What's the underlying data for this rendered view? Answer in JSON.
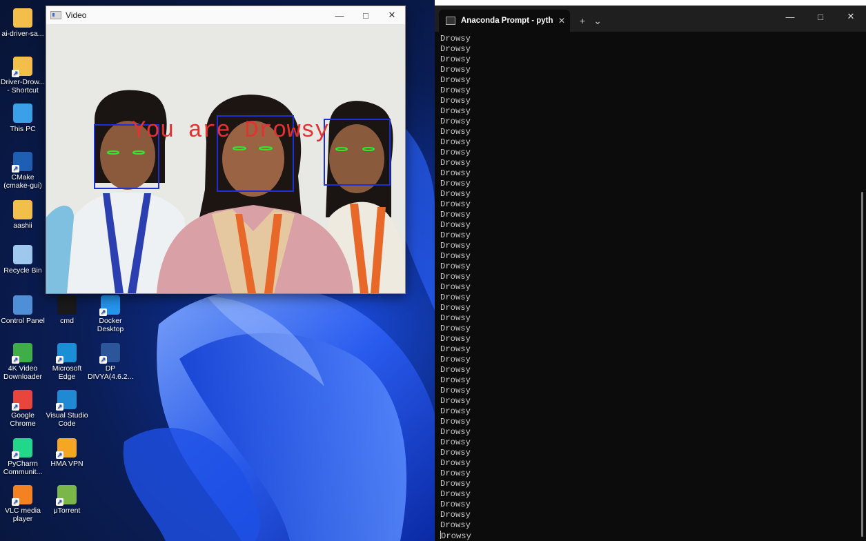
{
  "desktop": {
    "icons": [
      {
        "label": "ai-driver-sa...",
        "icon": "folder-icon",
        "color": "#f2c04a"
      },
      {
        "label": "Driver-Drow... - Shortcut",
        "icon": "folder-shortcut-icon",
        "color": "#f2c04a"
      },
      {
        "label": "This PC",
        "icon": "monitor-icon",
        "color": "#3aa0e8"
      },
      {
        "label": "CMake (cmake-gui)",
        "icon": "cmake-icon",
        "color": "#1e5fb4"
      },
      {
        "label": "aashii",
        "icon": "folder-icon",
        "color": "#f2c04a"
      },
      {
        "label": "Recycle Bin",
        "icon": "recycle-bin-icon",
        "color": "#9ec8ee"
      },
      {
        "label": "Control Panel",
        "icon": "control-panel-icon",
        "color": "#4f8fd6"
      },
      {
        "label": "cmd",
        "icon": "cmd-icon",
        "color": "#1a1a1a"
      },
      {
        "label": "Docker Desktop",
        "icon": "docker-icon",
        "color": "#2496ed"
      },
      {
        "label": "4K Video Downloader",
        "icon": "video-downloader-icon",
        "color": "#3fae49"
      },
      {
        "label": "Microsoft Edge",
        "icon": "edge-icon",
        "color": "#1b8fd6"
      },
      {
        "label": "DP DIVYA(4.6.2...",
        "icon": "word-document-icon",
        "color": "#2b579a"
      },
      {
        "label": "Google Chrome",
        "icon": "chrome-icon",
        "color": "#e8453c"
      },
      {
        "label": "Visual Studio Code",
        "icon": "vscode-icon",
        "color": "#1f8ad2"
      },
      {
        "label": "PyCharm Communit...",
        "icon": "pycharm-icon",
        "color": "#21d789"
      },
      {
        "label": "HMA VPN",
        "icon": "hma-vpn-icon",
        "color": "#f5a623"
      },
      {
        "label": "VLC media player",
        "icon": "vlc-icon",
        "color": "#f58220"
      },
      {
        "label": "μTorrent",
        "icon": "utorrent-icon",
        "color": "#7ab648"
      }
    ]
  },
  "video_window": {
    "title": "Video",
    "minimize": "—",
    "maximize": "□",
    "close": "✕",
    "overlay_text": "You are Drowsy",
    "overlay_color": "#e23232",
    "box_color": "#1f2fd6",
    "eye_color": "#2ee82e"
  },
  "terminal": {
    "tab_title": "Anaconda Prompt - python  d",
    "tab_close": "✕",
    "new_tab": "+",
    "dropdown": "⌄",
    "minimize": "—",
    "maximize": "□",
    "close": "✕",
    "line_text": "Drowsy",
    "line_count": 49
  }
}
